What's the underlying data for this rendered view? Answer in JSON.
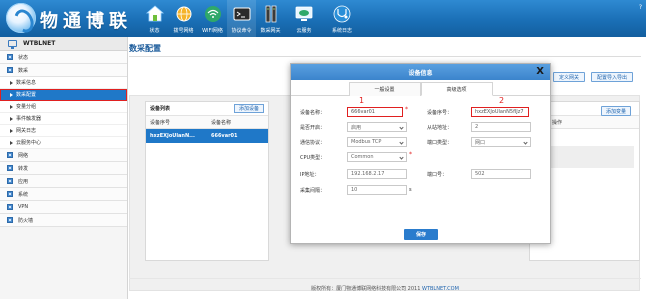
{
  "header": {
    "brand": "物通博联",
    "help": "?",
    "nav": [
      {
        "label": "状态",
        "icon": "house-icon"
      },
      {
        "label": "拨号网络",
        "icon": "globe-icon"
      },
      {
        "label": "WIFI网络",
        "icon": "wifi-icon"
      },
      {
        "label": "协议命令",
        "icon": "terminal-icon"
      },
      {
        "label": "数采网关",
        "icon": "server-icon"
      },
      {
        "label": "云服务",
        "icon": "cloud-icon"
      },
      {
        "label": "系统日志",
        "icon": "stethoscope-icon"
      }
    ]
  },
  "sidebar": {
    "title": "WTBLNET",
    "groups": [
      {
        "label": "状态"
      },
      {
        "label": "数采"
      },
      {
        "sub": [
          "数采信息",
          "数采配置",
          "变量分组",
          "事件触发器",
          "网关日志",
          "云服务中心"
        ]
      },
      {
        "label": "网络"
      },
      {
        "label": "转发"
      },
      {
        "label": "应用"
      },
      {
        "label": "系统"
      },
      {
        "label": "VPN"
      },
      {
        "label": "防火墙"
      }
    ]
  },
  "main": {
    "title": "数采配置",
    "btn_custom_gateway": "定义网关",
    "btn_import_export": "配置导入导出",
    "btn_add_var": "添加变量",
    "device_list": {
      "title": "设备列表",
      "add": "添加设备",
      "cols": [
        "设备序号",
        "设备名称"
      ],
      "rows": [
        [
          "hxzEXJoUlanN...",
          "666var01"
        ]
      ]
    },
    "right_panel": {
      "col": "操作"
    },
    "footer_prefix": "版权所有：厦门物通博联网络科技有限公司 2011",
    "footer_link": "WTBLNET.COM"
  },
  "modal": {
    "title": "设备信息",
    "close": "X",
    "tabs": [
      "一般设置",
      "高级选项"
    ],
    "fields": {
      "device_name_label": "设备名称：",
      "device_name_value": "666var01",
      "device_sn_label": "设备序号：",
      "device_sn_value": "hxzEXJoUlanN5fIJz7",
      "enable_label": "是否开启：",
      "enable_value": "启用",
      "slave_addr_label": "从站地址：",
      "slave_addr_value": "2",
      "protocol_label": "通信协议：",
      "protocol_value": "Modbus TCP",
      "port_type_label": "端口类型：",
      "port_type_value": "网口",
      "cpu_label": "CPU类型：",
      "cpu_value": "Common",
      "ip_label": "IP地址：",
      "ip_value": "192.168.2.17",
      "port_label": "端口号：",
      "port_value": "502",
      "interval_label": "采集间隔：",
      "interval_value": "10",
      "interval_unit": "s"
    },
    "annotations": [
      "1",
      "2"
    ],
    "save": "保存"
  },
  "colors": {
    "header_blue": "#1a6fb6",
    "accent_blue": "#1f78c8",
    "highlight_red": "#e02020"
  }
}
